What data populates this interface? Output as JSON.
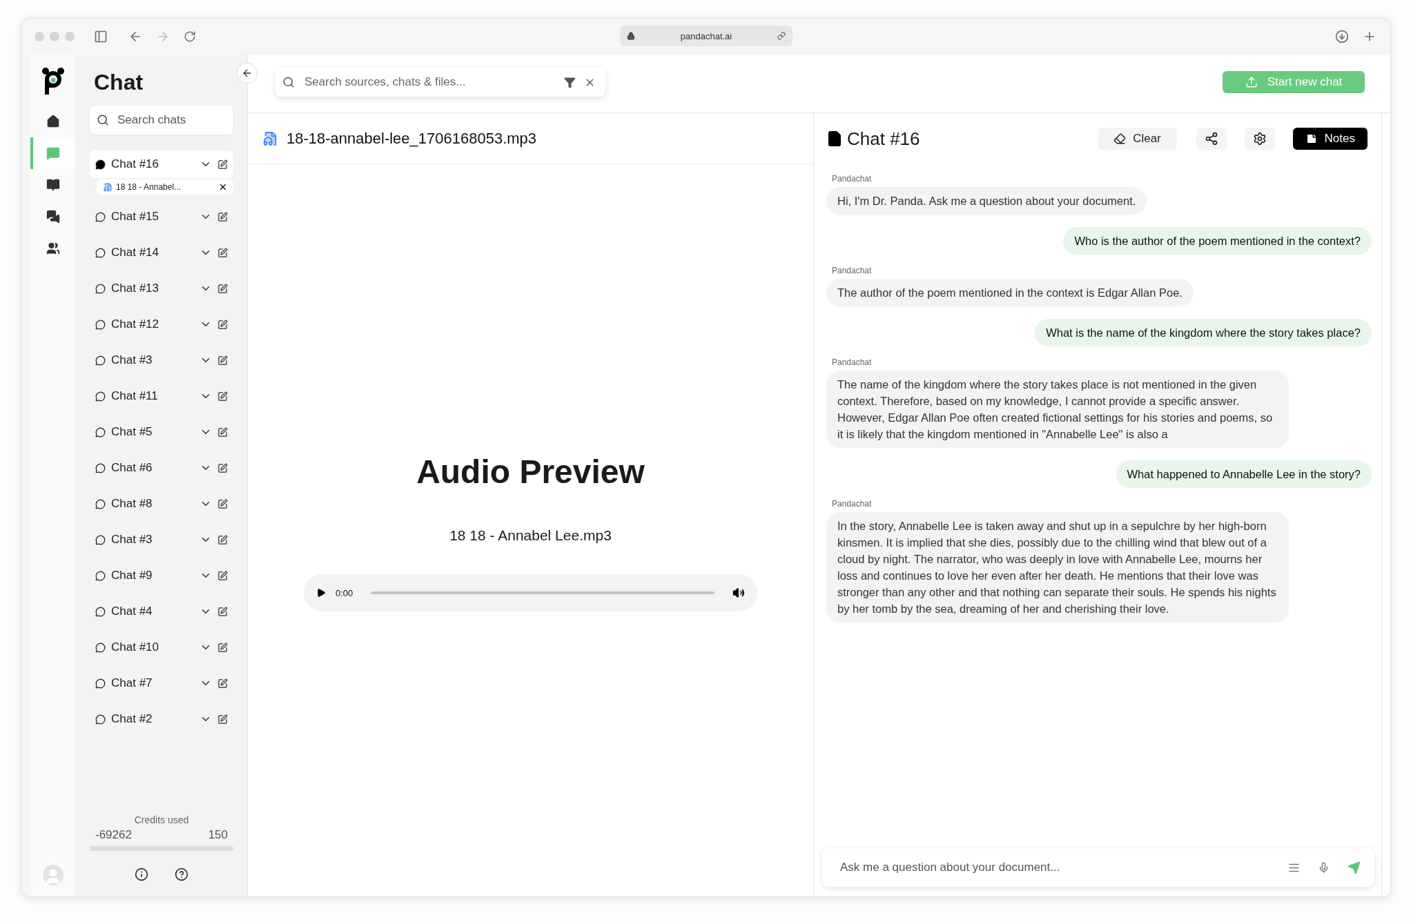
{
  "browser": {
    "url": "pandachat.ai"
  },
  "nav": [
    {
      "kind": "home",
      "selected": false
    },
    {
      "kind": "chat",
      "selected": true
    },
    {
      "kind": "library",
      "selected": false
    },
    {
      "kind": "conversations",
      "selected": false
    },
    {
      "kind": "team",
      "selected": false
    }
  ],
  "sidebar": {
    "title": "Chat",
    "search": {
      "placeholder": "Search chats"
    },
    "chats": [
      {
        "name": "Chat #16",
        "selected": true,
        "files": [
          "18 18 - Annabel..."
        ]
      },
      {
        "name": "Chat #15",
        "selected": false
      },
      {
        "name": "Chat #14",
        "selected": false
      },
      {
        "name": "Chat #13",
        "selected": false
      },
      {
        "name": "Chat #12",
        "selected": false
      },
      {
        "name": "Chat #3",
        "selected": false
      },
      {
        "name": "Chat #11",
        "selected": false
      },
      {
        "name": "Chat #5",
        "selected": false
      },
      {
        "name": "Chat #6",
        "selected": false
      },
      {
        "name": "Chat #8",
        "selected": false
      },
      {
        "name": "Chat #3",
        "selected": false
      },
      {
        "name": "Chat #9",
        "selected": false
      },
      {
        "name": "Chat #4",
        "selected": false
      },
      {
        "name": "Chat #10",
        "selected": false
      },
      {
        "name": "Chat #7",
        "selected": false
      },
      {
        "name": "Chat #2",
        "selected": false
      }
    ],
    "credits": {
      "label": "Credits used",
      "used": "-69262",
      "total": "150"
    }
  },
  "search": {
    "placeholder": "Search sources, chats & files..."
  },
  "start_button": "Start new chat",
  "preview": {
    "file_name": "18-18-annabel-lee_1706168053.mp3",
    "heading": "Audio Preview",
    "audio_title": "18 18 - Annabel Lee.mp3",
    "time": "0:00"
  },
  "chat": {
    "title": "Chat #16",
    "clear_button": "Clear",
    "notes_button": "Notes",
    "messages": [
      {
        "kind": "bot",
        "sender": "Pandachat",
        "text": "Hi, I'm Dr. Panda. Ask me a question about your document."
      },
      {
        "kind": "user",
        "text": "Who is the author of the poem mentioned in the context?"
      },
      {
        "kind": "bot",
        "sender": "Pandachat",
        "text": "The author of the poem mentioned in the context is Edgar Allan Poe."
      },
      {
        "kind": "user",
        "text": "What is the name of the kingdom where the story takes place?"
      },
      {
        "kind": "bot",
        "sender": "Pandachat",
        "text": "The name of the kingdom where the story takes place is not mentioned in the given context. Therefore, based on my knowledge, I cannot provide a specific answer. However, Edgar Allan Poe often created fictional settings for his stories and poems, so it is likely that the kingdom mentioned in \"Annabelle Lee\" is also a"
      },
      {
        "kind": "user",
        "text": "What happened to Annabelle Lee in the story?"
      },
      {
        "kind": "bot",
        "sender": "Pandachat",
        "text": "In the story, Annabelle Lee is taken away and shut up in a sepulchre by her high-born kinsmen. It is implied that she dies, possibly due to the chilling wind that blew out of a cloud by night. The narrator, who was deeply in love with Annabelle Lee, mourns her loss and continues to love her even after her death. He mentions that their love was stronger than any other and that nothing can separate their souls. He spends his nights by her tomb by the sea, dreaming of her and cherishing their love."
      }
    ],
    "input": {
      "placeholder": "Ask me a question about your document..."
    }
  }
}
